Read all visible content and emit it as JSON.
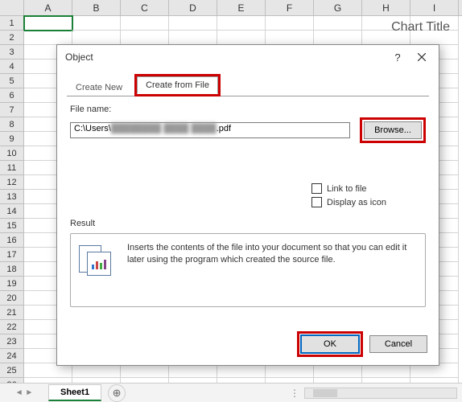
{
  "columns": [
    "A",
    "B",
    "C",
    "D",
    "E",
    "F",
    "G",
    "H",
    "I"
  ],
  "rowCount": 26,
  "chart_title": "Chart Title",
  "dialog": {
    "title": "Object",
    "tabs": {
      "create_new": "Create New",
      "create_from_file": "Create from File"
    },
    "file_name_label": "File name:",
    "file_path_prefix": "C:\\Users\\",
    "file_path_blurred": "████████ ████ ████",
    "file_path_suffix": ".pdf",
    "browse": "Browse...",
    "link_to_file": "Link to file",
    "display_as_icon": "Display as icon",
    "result_label": "Result",
    "result_text": "Inserts the contents of the file into your document so that you can edit it later using the program which created the source file.",
    "ok": "OK",
    "cancel": "Cancel"
  },
  "sheet": {
    "name": "Sheet1"
  }
}
